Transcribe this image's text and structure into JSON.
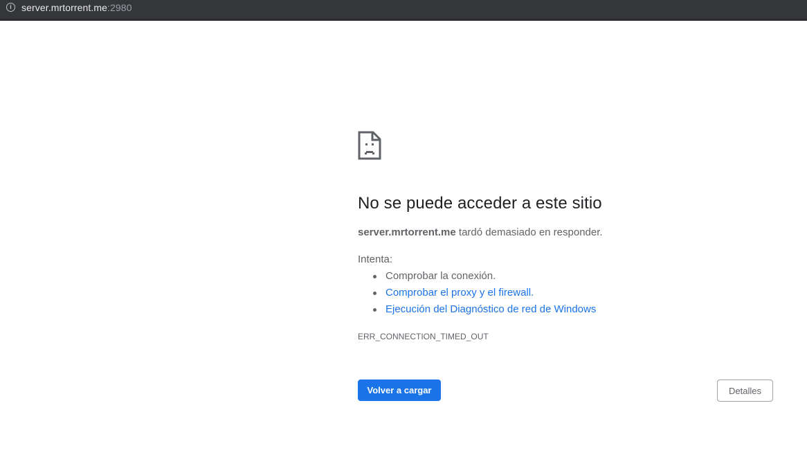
{
  "address_bar": {
    "icon": "info-icon",
    "url_host": "server.mrtorrent.me",
    "url_port": ":2980"
  },
  "error": {
    "icon": "sad-document-icon",
    "headline": "No se puede acceder a este sitio",
    "host": "server.mrtorrent.me",
    "summary_rest": " tardó demasiado en responder.",
    "try_label": "Intenta:",
    "suggestions": [
      {
        "text": "Comprobar la conexión.",
        "link": false
      },
      {
        "text": "Comprobar el proxy y el firewall.",
        "link": true
      },
      {
        "text": "Ejecución del Diagnóstico de red de Windows",
        "link": true
      }
    ],
    "code": "ERR_CONNECTION_TIMED_OUT"
  },
  "buttons": {
    "reload_label": "Volver a cargar",
    "details_label": "Detalles"
  },
  "colors": {
    "accent": "#1a73e8",
    "text": "#5f6368",
    "heading": "#202124",
    "toolbar": "#35363a"
  }
}
